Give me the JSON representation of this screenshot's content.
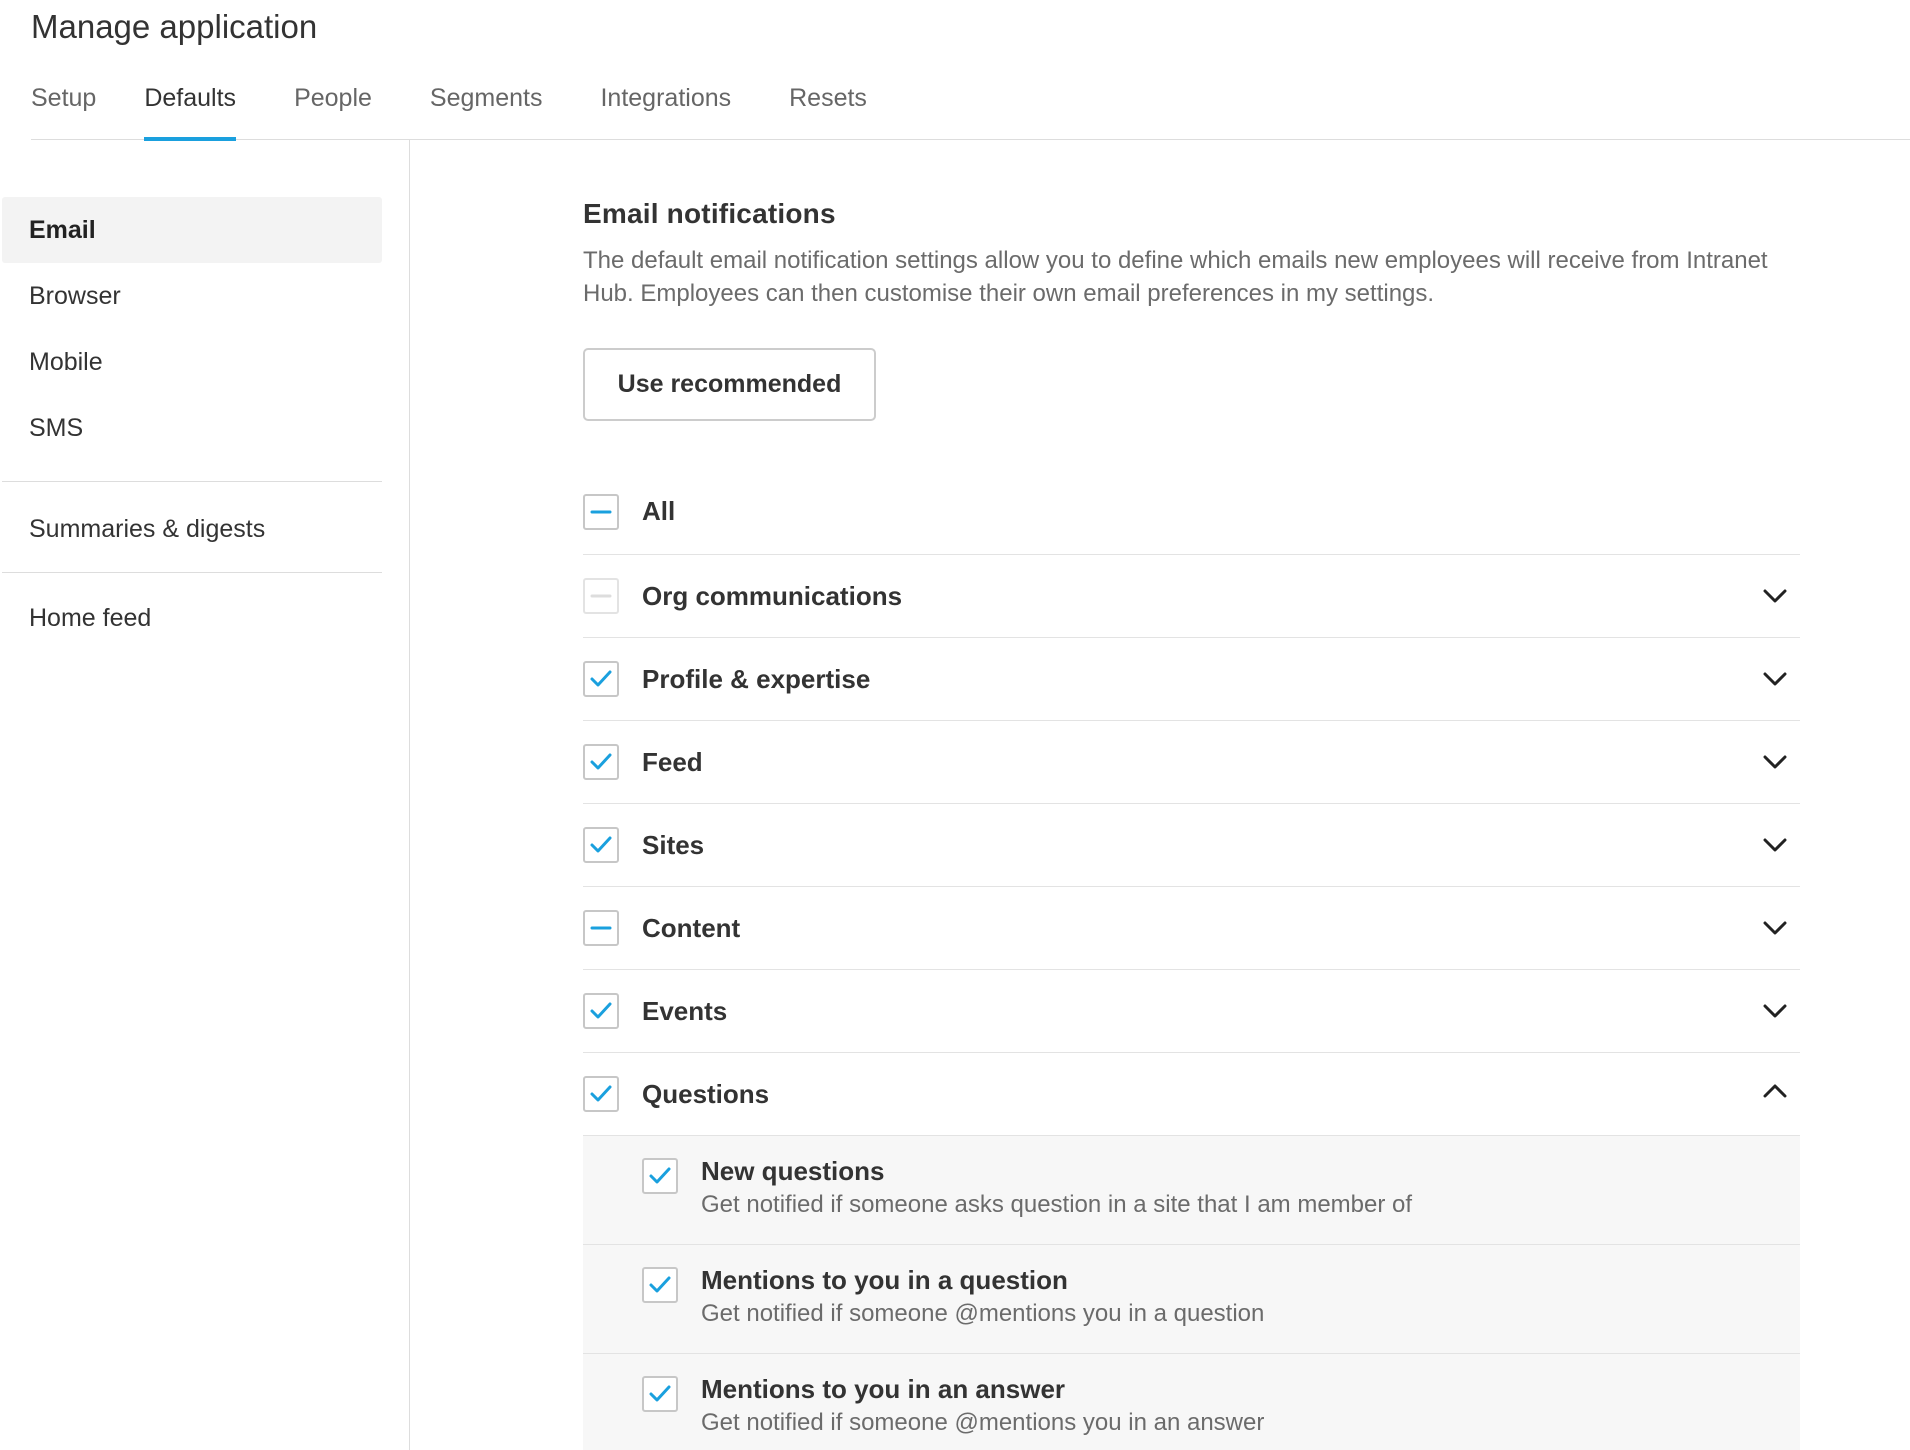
{
  "page": {
    "title": "Manage application"
  },
  "tabs": [
    {
      "label": "Setup",
      "active": false
    },
    {
      "label": "Defaults",
      "active": true
    },
    {
      "label": "People",
      "active": false
    },
    {
      "label": "Segments",
      "active": false
    },
    {
      "label": "Integrations",
      "active": false
    },
    {
      "label": "Resets",
      "active": false
    }
  ],
  "sidebar": {
    "channels": [
      {
        "label": "Email",
        "active": true
      },
      {
        "label": "Browser",
        "active": false
      },
      {
        "label": "Mobile",
        "active": false
      },
      {
        "label": "SMS",
        "active": false
      }
    ],
    "summaries": {
      "label": "Summaries & digests"
    },
    "home_feed": {
      "label": "Home feed"
    }
  },
  "main": {
    "section_title": "Email notifications",
    "section_description": "The default email notification settings allow you to define which emails new employees will receive from Intranet Hub. Employees can then customise their own email preferences in my settings.",
    "use_recommended_label": "Use recommended",
    "all": {
      "label": "All",
      "state": "indeterminate"
    },
    "categories": [
      {
        "label": "Org communications",
        "state": "indeterminate-disabled",
        "expanded": false
      },
      {
        "label": "Profile & expertise",
        "state": "checked",
        "expanded": false
      },
      {
        "label": "Feed",
        "state": "checked",
        "expanded": false
      },
      {
        "label": "Sites",
        "state": "checked",
        "expanded": false
      },
      {
        "label": "Content",
        "state": "indeterminate",
        "expanded": false
      },
      {
        "label": "Events",
        "state": "checked",
        "expanded": false
      },
      {
        "label": "Questions",
        "state": "checked",
        "expanded": true
      }
    ],
    "question_items": [
      {
        "title": "New questions",
        "description": "Get notified if someone asks question in a site that I am member of",
        "state": "checked"
      },
      {
        "title": "Mentions to you in a question",
        "description": "Get notified if someone @mentions you in a question",
        "state": "checked"
      },
      {
        "title": "Mentions to you in an answer",
        "description": "Get notified if someone @mentions you in an answer",
        "state": "checked"
      }
    ]
  },
  "colors": {
    "accent": "#1aa0de",
    "text_primary": "#333333",
    "text_secondary": "#6b6b6b",
    "divider": "#dddddd",
    "sub_background": "#f7f7f7"
  },
  "icons": {
    "checked": "check-icon",
    "indeterminate": "minus-icon",
    "collapsed": "chevron-down-icon",
    "expanded": "chevron-up-icon"
  }
}
